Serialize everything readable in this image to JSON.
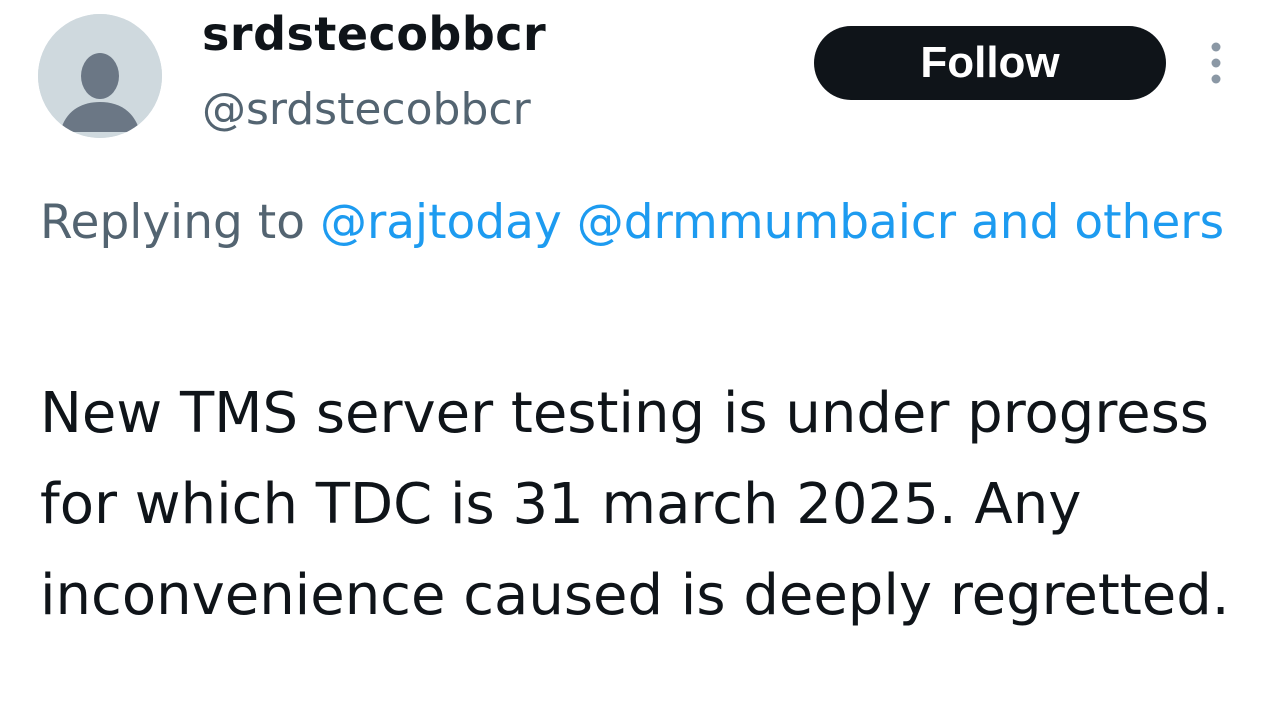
{
  "author": {
    "display_name": "srdstecobbcr",
    "handle": "@srdstecobbcr",
    "avatar_icon": "default-avatar-icon"
  },
  "follow_button": {
    "label": "Follow"
  },
  "more_menu": {
    "icon": "more-vertical-icon"
  },
  "reply": {
    "prefix": "Replying to",
    "mentions": [
      "@rajtoday",
      "@drmmumbaicr"
    ],
    "others_link": "and others"
  },
  "tweet": {
    "text": "New TMS server testing is under progress for which TDC is 31 march 2025. Any inconvenience caused is deeply regretted."
  },
  "colors": {
    "link": "#1d9bf0",
    "secondary_text": "#536471",
    "primary_text": "#0f1419",
    "button_bg": "#0f1419"
  }
}
